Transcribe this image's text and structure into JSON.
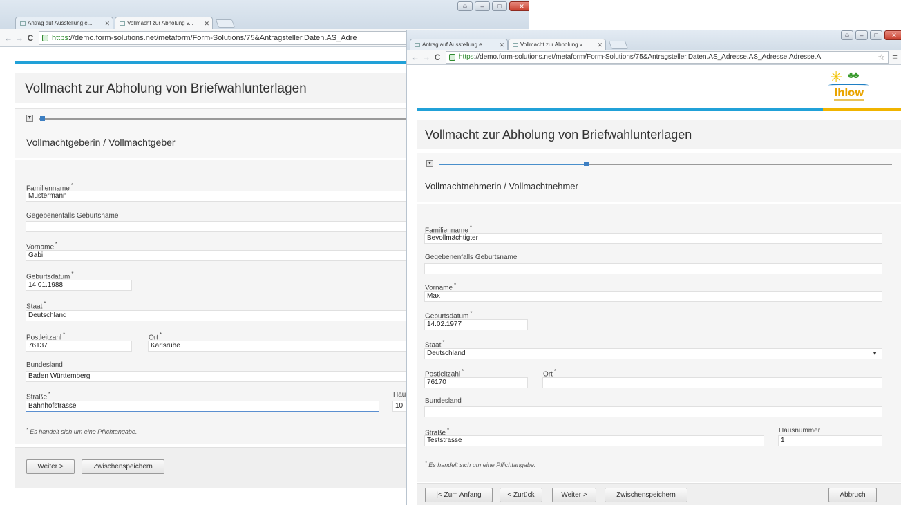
{
  "window_a": {
    "tabs": [
      {
        "label": "Antrag auf Ausstellung e..."
      },
      {
        "label": "Vollmacht zur Abholung v..."
      }
    ],
    "url": {
      "secure": "https",
      "rest": "://demo.form-solutions.net/metaform/Form-Solutions/75&Antragsteller.Daten.AS_Adre"
    },
    "page_title": "Vollmacht zur Abholung von Briefwahlunterlagen",
    "section_title": "Vollmachtgeberin / Vollmachtgeber",
    "fields": {
      "familienname": {
        "label": "Familienname",
        "value": "Mustermann"
      },
      "geburtsname": {
        "label": "Gegebenenfalls Geburtsname",
        "value": ""
      },
      "vorname": {
        "label": "Vorname",
        "value": "Gabi"
      },
      "geburtsdatum": {
        "label": "Geburtsdatum",
        "value": "14.01.1988"
      },
      "staat": {
        "label": "Staat",
        "value": "Deutschland"
      },
      "plz": {
        "label": "Postleitzahl",
        "value": "76137"
      },
      "ort": {
        "label": "Ort",
        "value": "Karlsruhe"
      },
      "bundesland": {
        "label": "Bundesland",
        "value": "Baden Württemberg"
      },
      "strasse": {
        "label": "Straße",
        "value": "Bahnhofstrasse"
      },
      "hausnummer": {
        "label": "Hau",
        "value": "10"
      }
    },
    "required_mark": "*",
    "note": "Es handelt sich um eine Pflichtangabe.",
    "buttons": {
      "weiter": "Weiter >",
      "zwischenspeichern": "Zwischenspeichern"
    }
  },
  "window_b": {
    "tabs": [
      {
        "label": "Antrag auf Ausstellung e..."
      },
      {
        "label": "Vollmacht zur Abholung v..."
      }
    ],
    "url": {
      "secure": "https",
      "rest": "://demo.form-solutions.net/metaform/Form-Solutions/75&Antragsteller.Daten.AS_Adresse.AS_Adresse.Adresse.A"
    },
    "logo_text": "Ihlow",
    "page_title": "Vollmacht zur Abholung von Briefwahlunterlagen",
    "section_title": "Vollmachtnehmerin / Vollmachtnehmer",
    "fields": {
      "familienname": {
        "label": "Familienname",
        "value": "Bevollmächtigter"
      },
      "geburtsname": {
        "label": "Gegebenenfalls Geburtsname",
        "value": ""
      },
      "vorname": {
        "label": "Vorname",
        "value": "Max"
      },
      "geburtsdatum": {
        "label": "Geburtsdatum",
        "value": "14.02.1977"
      },
      "staat": {
        "label": "Staat",
        "value": "Deutschland"
      },
      "plz": {
        "label": "Postleitzahl",
        "value": "76170"
      },
      "ort": {
        "label": "Ort",
        "value": ""
      },
      "bundesland": {
        "label": "Bundesland",
        "value": ""
      },
      "strasse": {
        "label": "Straße",
        "value": "Teststrasse"
      },
      "hausnummer": {
        "label": "Hausnummer",
        "value": "1"
      }
    },
    "required_mark": "*",
    "note": "Es handelt sich um eine Pflichtangabe.",
    "buttons": {
      "zum_anfang": "|< Zum Anfang",
      "zurueck": "< Zurück",
      "weiter": "Weiter >",
      "zwischenspeichern": "Zwischenspeichern",
      "abbruch": "Abbruch"
    }
  }
}
